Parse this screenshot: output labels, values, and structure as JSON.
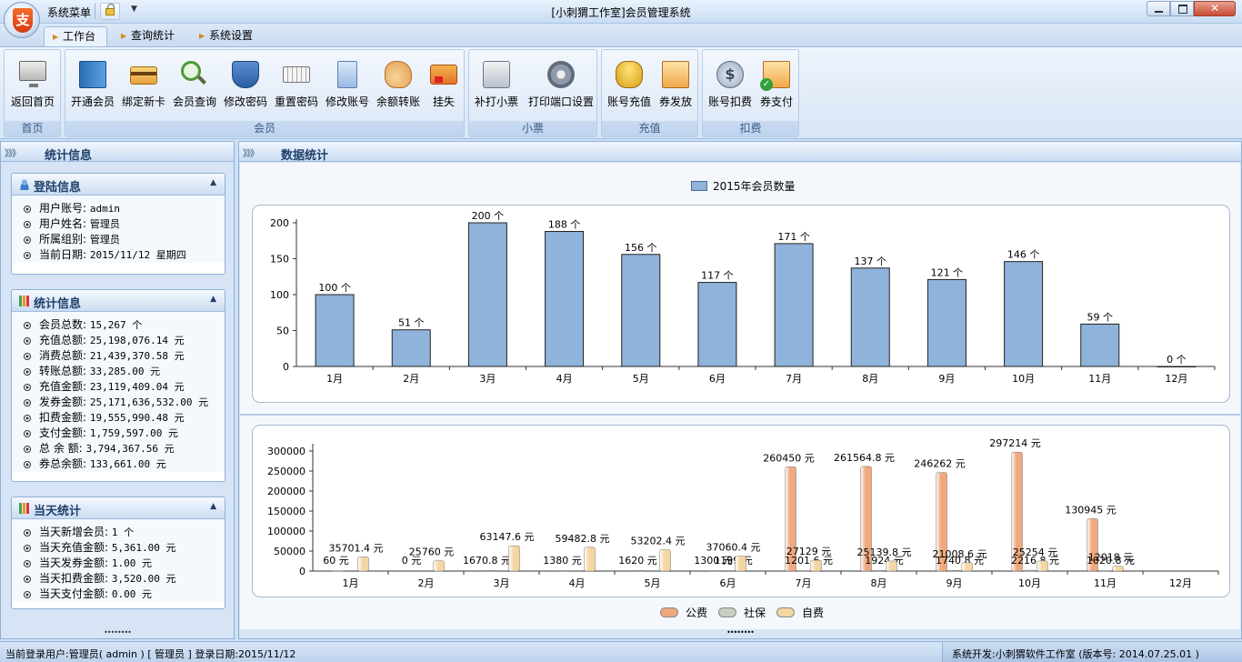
{
  "window": {
    "title": "[小刺猬工作室]会员管理系统",
    "logo_char": "支",
    "system_menu": "系统菜单"
  },
  "tabs": [
    {
      "label": "工作台",
      "active": true
    },
    {
      "label": "查询统计",
      "active": false
    },
    {
      "label": "系统设置",
      "active": false
    }
  ],
  "ribbon": {
    "groups": [
      {
        "label": "首页",
        "buttons": [
          {
            "label": "返回首页",
            "icon": "monitor-icon"
          }
        ]
      },
      {
        "label": "会员",
        "buttons": [
          {
            "label": "开通会员",
            "icon": "book-icon"
          },
          {
            "label": "绑定新卡",
            "icon": "card-icon"
          },
          {
            "label": "会员查询",
            "icon": "search-icon"
          },
          {
            "label": "修改密码",
            "icon": "shield-icon"
          },
          {
            "label": "重置密码",
            "icon": "keyboard-icon"
          },
          {
            "label": "修改账号",
            "icon": "pen-icon"
          },
          {
            "label": "余额转账",
            "icon": "handshake-icon"
          },
          {
            "label": "挂失",
            "icon": "report-loss-icon"
          }
        ]
      },
      {
        "label": "小票",
        "buttons": [
          {
            "label": "补打小票",
            "icon": "printer-icon"
          },
          {
            "label": "打印端口设置",
            "icon": "gear-icon"
          }
        ]
      },
      {
        "label": "充值",
        "buttons": [
          {
            "label": "账号充值",
            "icon": "coins-icon"
          },
          {
            "label": "券发放",
            "icon": "ticket-icon"
          }
        ]
      },
      {
        "label": "扣费",
        "buttons": [
          {
            "label": "账号扣费",
            "icon": "dollar-icon"
          },
          {
            "label": "券支付",
            "icon": "ticket-pay-icon"
          }
        ]
      }
    ]
  },
  "sidebar": {
    "title": "统计信息",
    "login": {
      "title": "登陆信息",
      "rows": [
        {
          "label": "用户账号:",
          "value": "admin"
        },
        {
          "label": "用户姓名:",
          "value": "管理员"
        },
        {
          "label": "所属组别:",
          "value": "管理员"
        },
        {
          "label": "当前日期:",
          "value": "2015/11/12 星期四"
        }
      ]
    },
    "stats": {
      "title": "统计信息",
      "rows": [
        {
          "label": "会员总数:",
          "value": "15,267 个"
        },
        {
          "label": "充值总额:",
          "value": "25,198,076.14 元"
        },
        {
          "label": "消费总额:",
          "value": "21,439,370.58 元"
        },
        {
          "label": "转账总额:",
          "value": "33,285.00 元"
        },
        {
          "label": "充值金额:",
          "value": "23,119,409.04 元"
        },
        {
          "label": "发券金额:",
          "value": "25,171,636,532.00 元"
        },
        {
          "label": "扣费金额:",
          "value": "19,555,990.48 元"
        },
        {
          "label": "支付金额:",
          "value": "1,759,597.00 元"
        },
        {
          "label": "总 余 额:",
          "value": "3,794,367.56 元"
        },
        {
          "label": "券总余额:",
          "value": "133,661.00 元"
        }
      ]
    },
    "today": {
      "title": "当天统计",
      "rows": [
        {
          "label": "当天新增会员:",
          "value": "1 个"
        },
        {
          "label": "当天充值金额:",
          "value": "5,361.00 元"
        },
        {
          "label": "当天发券金额:",
          "value": "1.00 元"
        },
        {
          "label": "当天扣费金额:",
          "value": "3,520.00 元"
        },
        {
          "label": "当天支付金额:",
          "value": "0.00 元"
        }
      ]
    }
  },
  "main": {
    "title": "数据统计"
  },
  "chart_data": [
    {
      "type": "bar",
      "categories": [
        "1月",
        "2月",
        "3月",
        "4月",
        "5月",
        "6月",
        "7月",
        "8月",
        "9月",
        "10月",
        "11月",
        "12月"
      ],
      "series": [
        {
          "name": "2015年会员数量",
          "values": [
            100,
            51,
            200,
            188,
            156,
            117,
            171,
            137,
            121,
            146,
            59,
            0
          ]
        }
      ],
      "value_suffix": " 个",
      "ylim": [
        0,
        200
      ],
      "yticks": [
        0,
        50,
        100,
        150,
        200
      ],
      "legend": "top-center",
      "grid": false,
      "colors": [
        "#8fb3da"
      ]
    },
    {
      "type": "bar",
      "categories": [
        "1月",
        "2月",
        "3月",
        "4月",
        "5月",
        "6月",
        "7月",
        "8月",
        "9月",
        "10月",
        "11月",
        "12月"
      ],
      "series": [
        {
          "name": "公费",
          "values": [
            60,
            0,
            1670.8,
            1380,
            1620,
            1300,
            260450,
            261564.8,
            246262,
            297214,
            130945,
            0
          ]
        },
        {
          "name": "社保",
          "values": [
            0,
            0,
            0,
            0,
            0,
            0,
            1201.6,
            1924,
            1740.8,
            2216.8,
            1020.8,
            0
          ]
        },
        {
          "name": "自费",
          "values": [
            35701.4,
            25760,
            63147.6,
            59482.8,
            53202.4,
            37060.4,
            27129,
            25139.8,
            21008.6,
            25254,
            12018,
            0
          ]
        }
      ],
      "labels": [
        [
          "60 元",
          "0 元",
          "1670.8 元",
          "1380 元",
          "1620 元",
          "1300 元",
          "260450 元",
          "261564.8 元",
          "246262 元",
          "297214 元",
          "130945 元",
          ""
        ],
        [
          "",
          "",
          "",
          "",
          "",
          "1199 元",
          "1201.6 元",
          "1924 元",
          "1740.8 元",
          "2216.8 元",
          "1020.8 元",
          ""
        ],
        [
          "35701.4 元",
          "25760 元",
          "63147.6 元",
          "59482.8 元",
          "53202.4 元",
          "37060.4 元",
          "27129 元",
          "25139.8 元",
          "21008.6 元",
          "25254 元",
          "12018 元",
          ""
        ]
      ],
      "ylim": [
        0,
        300000
      ],
      "yticks": [
        0,
        50000,
        100000,
        150000,
        200000,
        250000,
        300000
      ],
      "legend": "bottom-center",
      "grid": false,
      "colors": [
        "#f0a87e",
        "#c6cfc0",
        "#f4d6a2"
      ]
    }
  ],
  "statusbar": {
    "left": "当前登录用户:管理员( admin ) [ 管理员 ] 登录日期:2015/11/12",
    "right": "系统开发:小刺猬软件工作室 (版本号: 2014.07.25.01 )"
  }
}
